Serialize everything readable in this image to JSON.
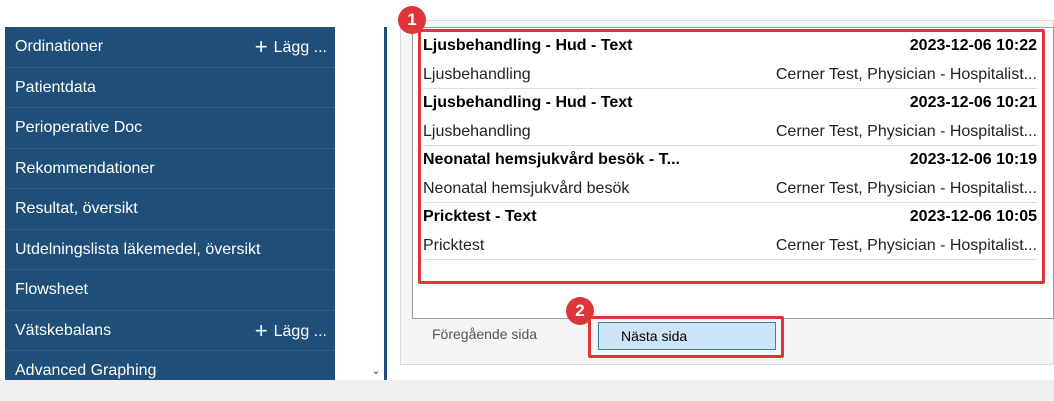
{
  "sidebar": {
    "items": [
      {
        "label": "Ordinationer",
        "add": "Lägg ..."
      },
      {
        "label": "Patientdata"
      },
      {
        "label": "Perioperative Doc"
      },
      {
        "label": "Rekommendationer"
      },
      {
        "label": "Resultat, översikt"
      },
      {
        "label": "Utdelningslista läkemedel, översikt"
      },
      {
        "label": "Flowsheet"
      },
      {
        "label": "Vätskebalans",
        "add": "Lägg ..."
      },
      {
        "label": "Advanced Graphing"
      }
    ],
    "plus_glyph": "+",
    "scroll_arrow": "⌄"
  },
  "documents": {
    "rows": [
      {
        "title": "Ljusbehandling - Hud - Text",
        "datetime": "2023-12-06 10:22",
        "type": "Ljusbehandling",
        "author": "Cerner Test, Physician - Hospitalist..."
      },
      {
        "title": "Ljusbehandling - Hud - Text",
        "datetime": "2023-12-06 10:21",
        "type": "Ljusbehandling",
        "author": "Cerner Test, Physician - Hospitalist..."
      },
      {
        "title": "Neonatal hemsjukvård besök - T...",
        "datetime": "2023-12-06 10:19",
        "type": "Neonatal hemsjukvård besök",
        "author": "Cerner Test, Physician - Hospitalist..."
      },
      {
        "title": "Pricktest - Text",
        "datetime": "2023-12-06 10:05",
        "type": "Pricktest",
        "author": "Cerner Test, Physician - Hospitalist..."
      }
    ]
  },
  "pagination": {
    "prev_label": "Föregående sida",
    "next_label": "Nästa sida"
  },
  "callouts": {
    "one": "1",
    "two": "2"
  },
  "colors": {
    "sidebar_bg": "#1f4e79",
    "callout_red": "#e0343b",
    "button_bg": "#cce4f7"
  }
}
